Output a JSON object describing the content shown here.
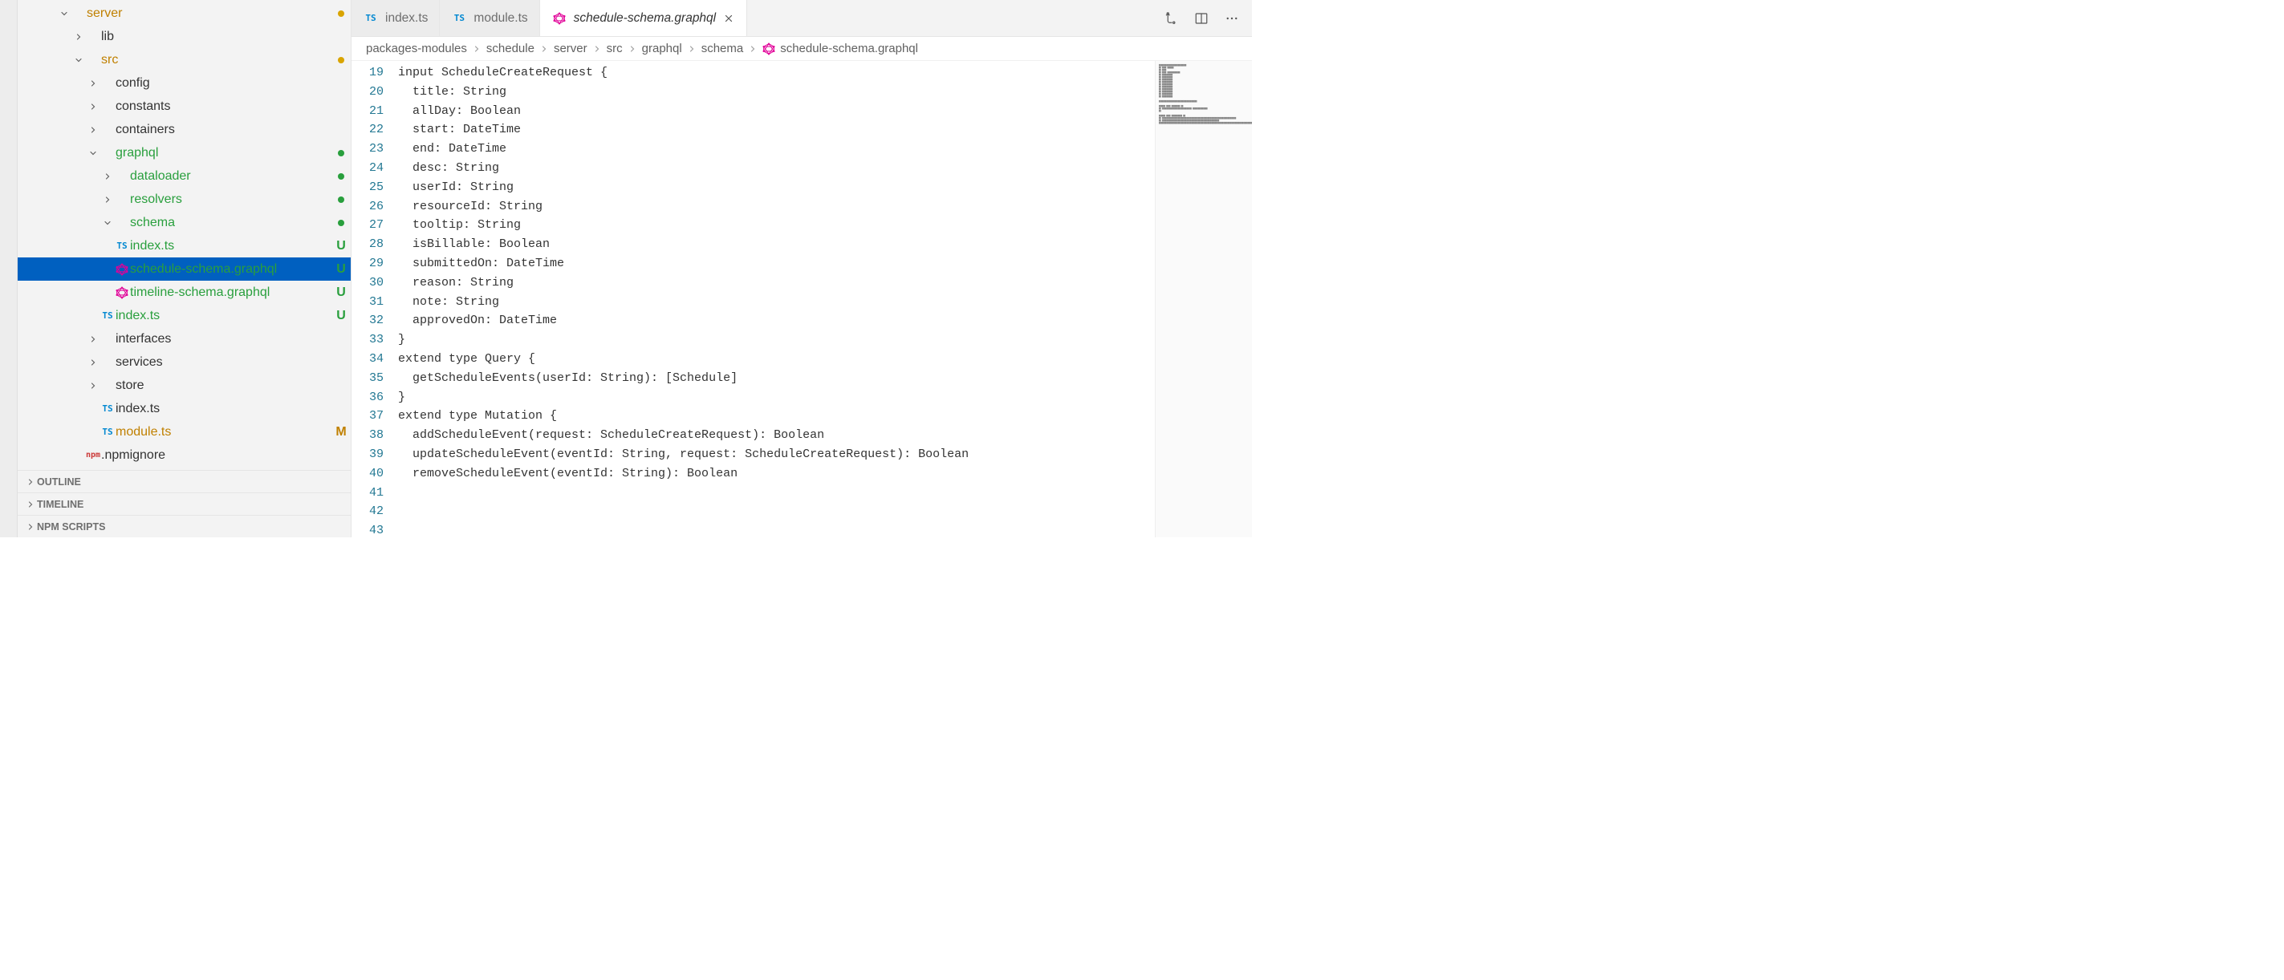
{
  "sidebar": {
    "tree": [
      {
        "indent": 50,
        "chev": "down",
        "icon": "",
        "label": "server",
        "cls": "folder-git-m",
        "status": "dot-yellow"
      },
      {
        "indent": 68,
        "chev": "right",
        "icon": "",
        "label": "lib",
        "cls": "",
        "status": ""
      },
      {
        "indent": 68,
        "chev": "down",
        "icon": "",
        "label": "src",
        "cls": "folder-git-m",
        "status": "dot-yellow"
      },
      {
        "indent": 86,
        "chev": "right",
        "icon": "",
        "label": "config",
        "cls": "",
        "status": ""
      },
      {
        "indent": 86,
        "chev": "right",
        "icon": "",
        "label": "constants",
        "cls": "",
        "status": ""
      },
      {
        "indent": 86,
        "chev": "right",
        "icon": "",
        "label": "containers",
        "cls": "",
        "status": ""
      },
      {
        "indent": 86,
        "chev": "down",
        "icon": "",
        "label": "graphql",
        "cls": "folder-git-u",
        "status": "dot-green"
      },
      {
        "indent": 104,
        "chev": "right",
        "icon": "",
        "label": "dataloader",
        "cls": "folder-git-u",
        "status": "dot-green"
      },
      {
        "indent": 104,
        "chev": "right",
        "icon": "",
        "label": "resolvers",
        "cls": "folder-git-u",
        "status": "dot-green"
      },
      {
        "indent": 104,
        "chev": "down",
        "icon": "",
        "label": "schema",
        "cls": "folder-git-u",
        "status": "dot-green"
      },
      {
        "indent": 104,
        "chev": "",
        "icon": "ts",
        "label": "index.ts",
        "cls": "folder-git-u",
        "status": "U"
      },
      {
        "indent": 104,
        "chev": "",
        "icon": "gql",
        "label": "schedule-schema.graphql",
        "cls": "folder-git-u",
        "status": "U",
        "selected": true
      },
      {
        "indent": 104,
        "chev": "",
        "icon": "gql",
        "label": "timeline-schema.graphql",
        "cls": "folder-git-u",
        "status": "U"
      },
      {
        "indent": 86,
        "chev": "",
        "icon": "ts",
        "label": "index.ts",
        "cls": "folder-git-u",
        "status": "U"
      },
      {
        "indent": 86,
        "chev": "right",
        "icon": "",
        "label": "interfaces",
        "cls": "",
        "status": ""
      },
      {
        "indent": 86,
        "chev": "right",
        "icon": "",
        "label": "services",
        "cls": "",
        "status": ""
      },
      {
        "indent": 86,
        "chev": "right",
        "icon": "",
        "label": "store",
        "cls": "",
        "status": ""
      },
      {
        "indent": 86,
        "chev": "",
        "icon": "ts",
        "label": "index.ts",
        "cls": "",
        "status": ""
      },
      {
        "indent": 86,
        "chev": "",
        "icon": "ts",
        "label": "module.ts",
        "cls": "folder-git-m",
        "status": "M"
      },
      {
        "indent": 68,
        "chev": "",
        "icon": "npm",
        "label": ".npmignore",
        "cls": "",
        "status": ""
      }
    ],
    "panels": [
      "OUTLINE",
      "TIMELINE",
      "NPM SCRIPTS"
    ]
  },
  "tabs": [
    {
      "icon": "ts",
      "label": "index.ts",
      "active": false
    },
    {
      "icon": "ts",
      "label": "module.ts",
      "active": false
    },
    {
      "icon": "gql",
      "label": "schedule-schema.graphql",
      "active": true,
      "close": true
    }
  ],
  "breadcrumbs": [
    "packages-modules",
    "schedule",
    "server",
    "src",
    "graphql",
    "schema",
    "schedule-schema.graphql"
  ],
  "editor": {
    "startLine": 19,
    "lines": [
      "",
      "input ScheduleCreateRequest {",
      "  title: String",
      "  allDay: Boolean",
      "  start: DateTime",
      "  end: DateTime",
      "  desc: String",
      "  userId: String",
      "  resourceId: String",
      "  tooltip: String",
      "  isBillable: Boolean",
      "  submittedOn: DateTime",
      "  reason: String",
      "  note: String",
      "  approvedOn: DateTime",
      "}",
      "",
      "extend type Query {",
      "  getScheduleEvents(userId: String): [Schedule]",
      "}",
      "",
      "extend type Mutation {",
      "  addScheduleEvent(request: ScheduleCreateRequest): Boolean",
      "  updateScheduleEvent(eventId: String, request: ScheduleCreateRequest): Boolean",
      "  removeScheduleEvent(eventId: String): Boolean"
    ]
  }
}
